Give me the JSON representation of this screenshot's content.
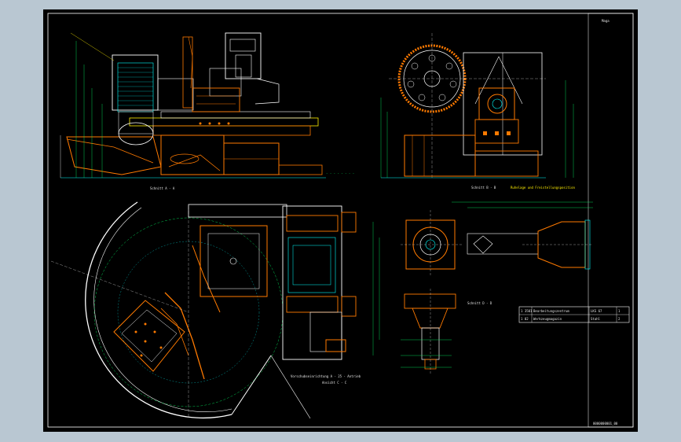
{
  "drawing": {
    "title_mark": "Maga",
    "section_a": "Schnitt A - A",
    "section_b": "Schnitt B - B",
    "section_c": "Ansicht C - C",
    "section_d": "Schnitt D - D",
    "note_center": "Vorschubseinrichtung A - 25 - Antrieb",
    "note_right_top": "Ruhelage und Freistellungsposition",
    "title_rows": [
      {
        "a": "1  3501",
        "b": "Bearbeitungszentrum",
        "c": "LKS 67",
        "d": "1"
      },
      {
        "a": "1  02",
        "b": "Werkzeugmagazin",
        "c": "Stahl",
        "d": "2"
      }
    ],
    "footer_code": "0000000001_00"
  }
}
